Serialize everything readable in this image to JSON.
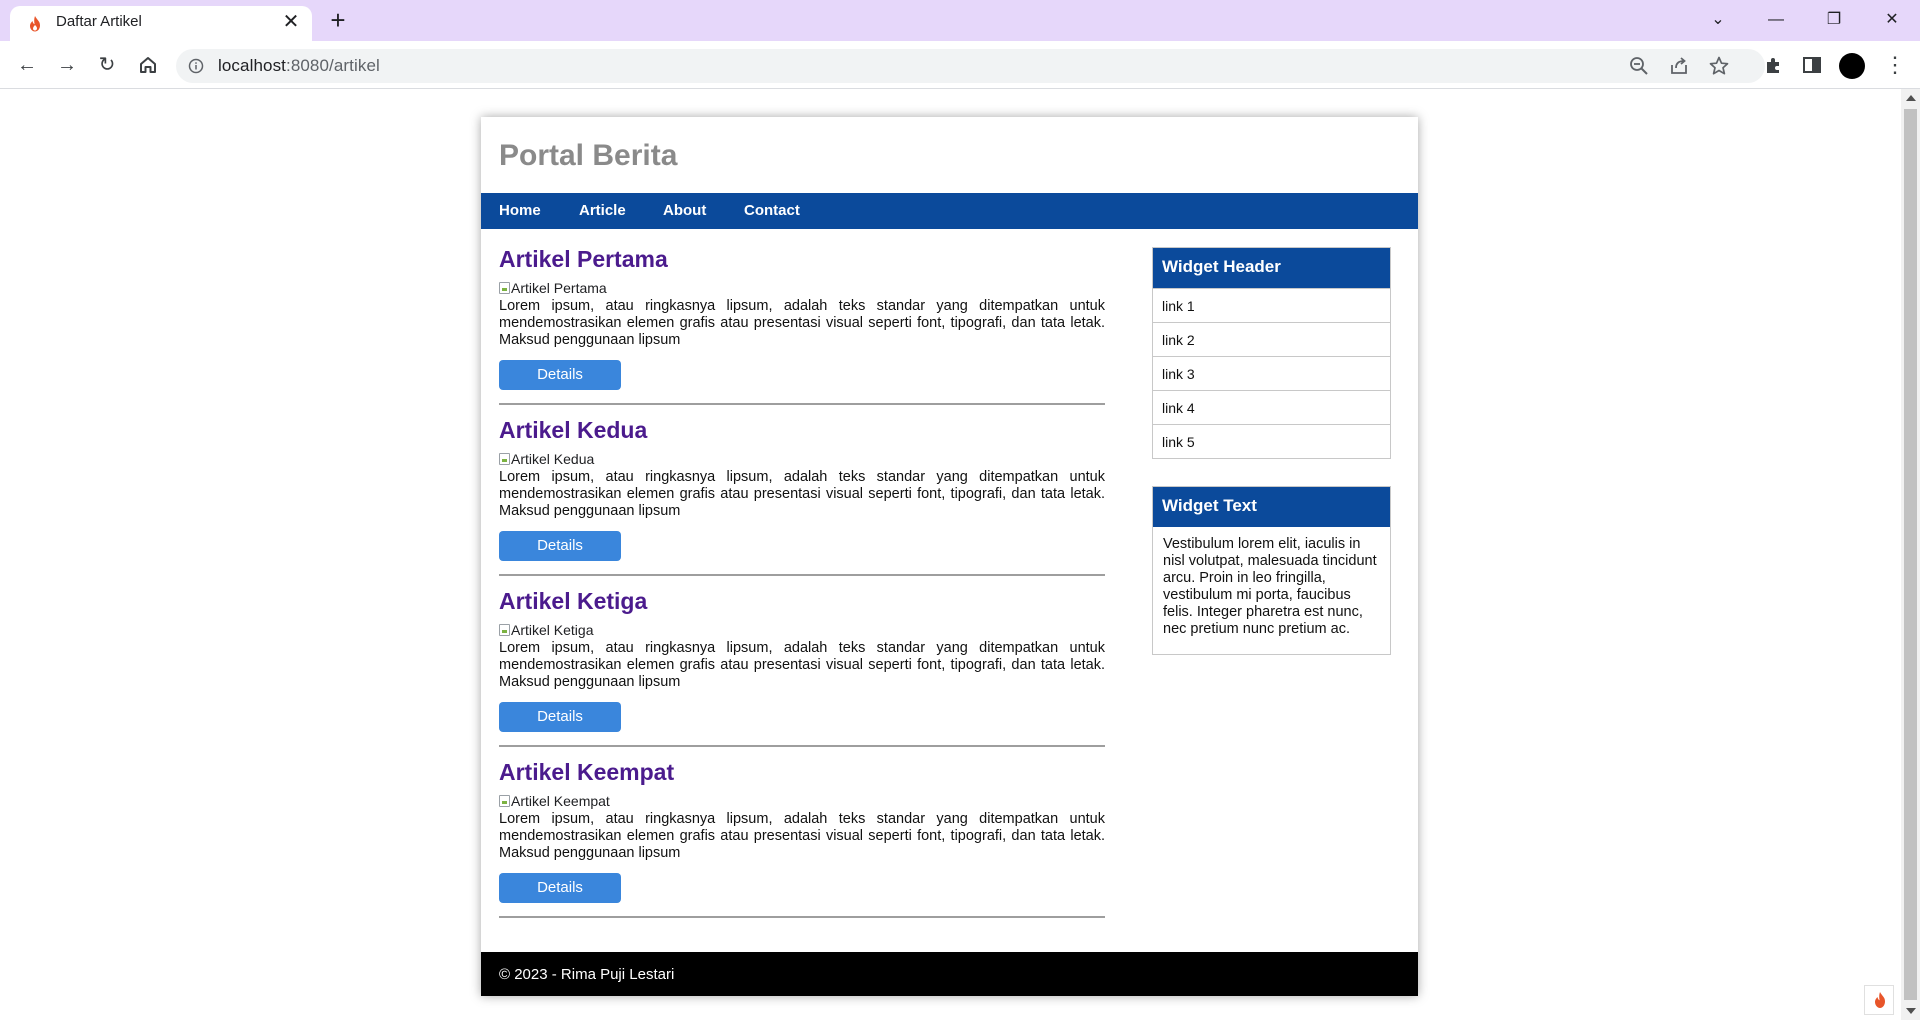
{
  "browser": {
    "tab_title": "Daftar Artikel",
    "close_glyph": "✕",
    "new_tab_glyph": "+",
    "url_host": "localhost",
    "url_rest": ":8080/artikel",
    "window_controls": {
      "dropdown": "⌄",
      "minimize": "—",
      "restore": "❐",
      "close": "✕"
    },
    "nav": {
      "back": "←",
      "forward": "→",
      "reload": "↻"
    },
    "menu_glyph": "⋮"
  },
  "site": {
    "title": "Portal Berita",
    "nav": [
      "Home",
      "Article",
      "About",
      "Contact"
    ],
    "articles": [
      {
        "title": "Artikel Pertama",
        "image_alt": "Artikel Pertama",
        "body": "Lorem ipsum, atau ringkasnya lipsum, adalah teks standar yang ditempatkan untuk mendemostrasikan elemen grafis atau presentasi visual seperti font, tipografi, dan tata letak. Maksud penggunaan lipsum",
        "button": "Details"
      },
      {
        "title": "Artikel Kedua",
        "image_alt": "Artikel Kedua",
        "body": "Lorem ipsum, atau ringkasnya lipsum, adalah teks standar yang ditempatkan untuk mendemostrasikan elemen grafis atau presentasi visual seperti font, tipografi, dan tata letak. Maksud penggunaan lipsum",
        "button": "Details"
      },
      {
        "title": "Artikel Ketiga",
        "image_alt": "Artikel Ketiga",
        "body": "Lorem ipsum, atau ringkasnya lipsum, adalah teks standar yang ditempatkan untuk mendemostrasikan elemen grafis atau presentasi visual seperti font, tipografi, dan tata letak. Maksud penggunaan lipsum",
        "button": "Details"
      },
      {
        "title": "Artikel Keempat",
        "image_alt": "Artikel Keempat",
        "body": "Lorem ipsum, atau ringkasnya lipsum, adalah teks standar yang ditempatkan untuk mendemostrasikan elemen grafis atau presentasi visual seperti font, tipografi, dan tata letak. Maksud penggunaan lipsum",
        "button": "Details"
      }
    ],
    "widget_links": {
      "header": "Widget Header",
      "links": [
        "link 1",
        "link 2",
        "link 3",
        "link 4",
        "link 5"
      ]
    },
    "widget_text": {
      "header": "Widget Text",
      "body": "Vestibulum lorem elit, iaculis in nisl volutpat, malesuada tincidunt arcu. Proin in leo fringilla, vestibulum mi porta, faucibus felis. Integer pharetra est nunc, nec pretium nunc pretium ac."
    },
    "footer": "© 2023 - Rima Puji Lestari"
  },
  "colors": {
    "nav_bar": "#0b4a9b",
    "article_title": "#4b1b8d",
    "details_button": "#3a86dc",
    "footer": "#000000",
    "tabstrip": "#e6d7fa"
  },
  "icons": {
    "favicon": "flame-icon",
    "info": "info-icon",
    "zoom": "zoom-out-icon",
    "share": "share-icon",
    "bookmark": "star-icon",
    "extensions": "puzzle-icon",
    "side_panel": "side-panel-icon"
  }
}
